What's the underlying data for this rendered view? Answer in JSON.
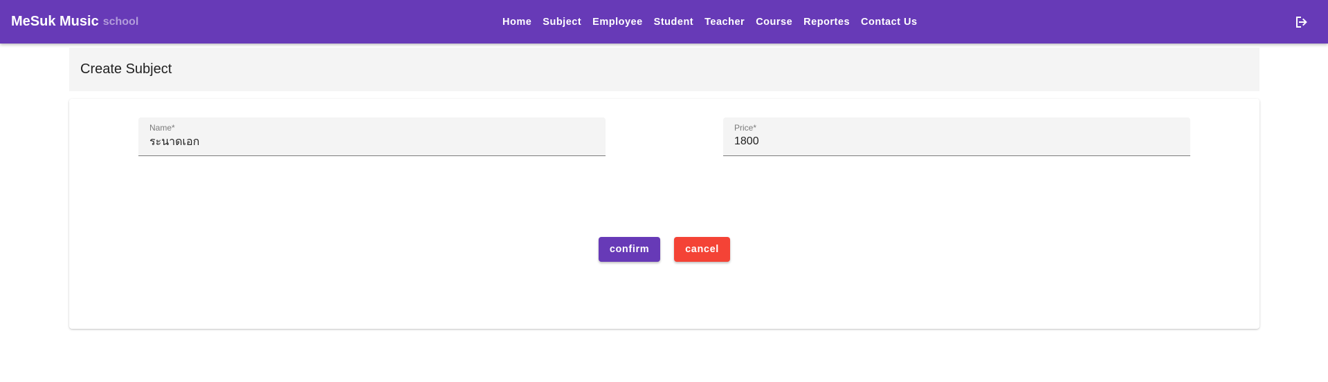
{
  "appbar": {
    "brand_main": "MeSuk Music",
    "brand_sub": "school",
    "background": "#673ab7",
    "logout_icon": "logout-icon"
  },
  "nav": {
    "items": [
      {
        "label": "Home"
      },
      {
        "label": "Subject"
      },
      {
        "label": "Employee"
      },
      {
        "label": "Student"
      },
      {
        "label": "Teacher"
      },
      {
        "label": "Course"
      },
      {
        "label": "Reportes"
      },
      {
        "label": "Contact Us"
      }
    ]
  },
  "page": {
    "title": "Create Subject"
  },
  "form": {
    "name_label": "Name*",
    "name_value": "ระนาดเอก",
    "price_label": "Price*",
    "price_value": "1800"
  },
  "actions": {
    "confirm_label": "confirm",
    "confirm_color": "#673ab7",
    "cancel_label": "cancel",
    "cancel_color": "#f44336"
  }
}
